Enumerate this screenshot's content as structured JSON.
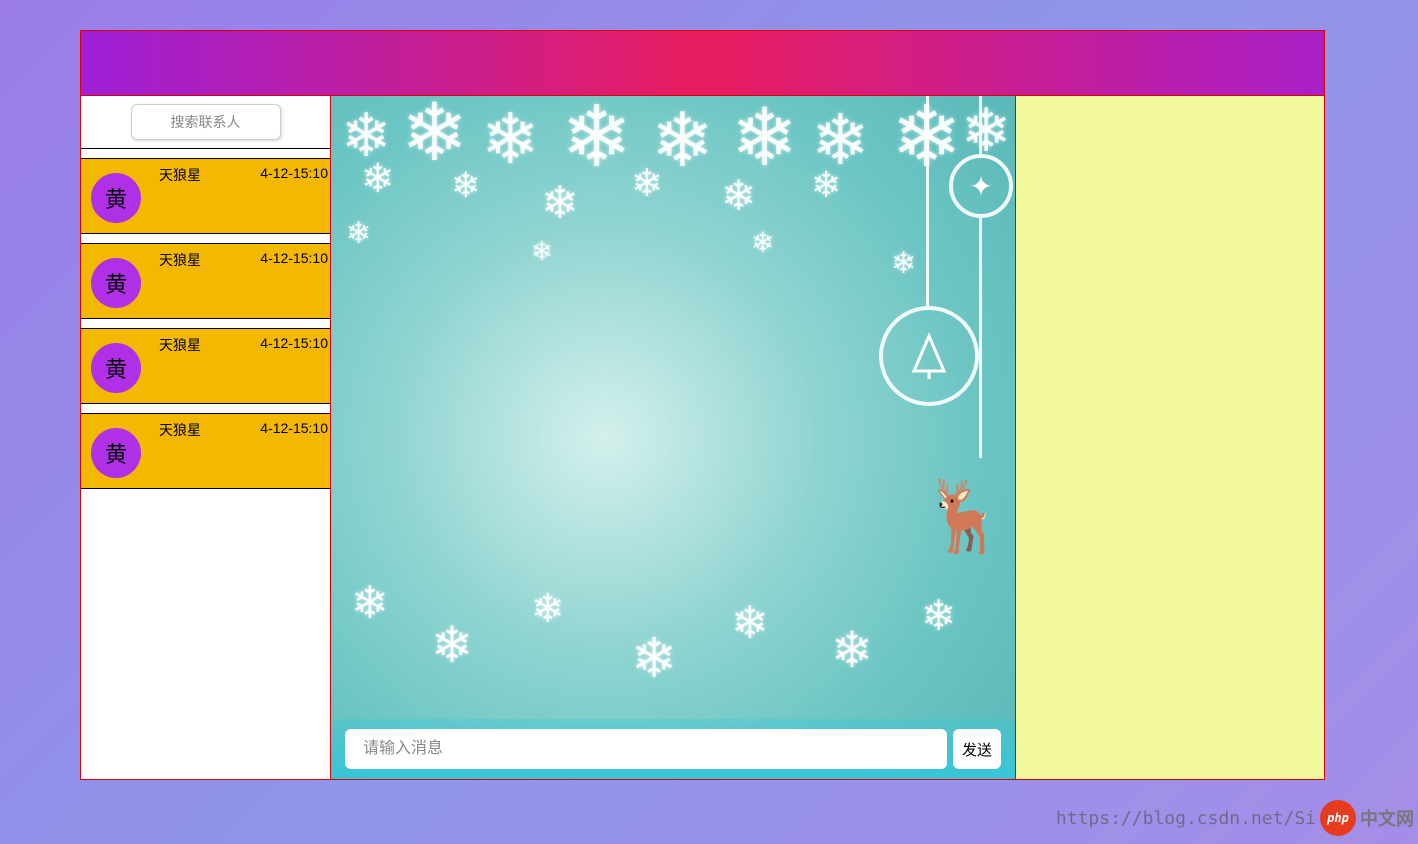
{
  "search": {
    "placeholder": "搜索联系人"
  },
  "contacts": [
    {
      "avatar_char": "黄",
      "name": "天狼星",
      "time": "4-12-15:10"
    },
    {
      "avatar_char": "黄",
      "name": "天狼星",
      "time": "4-12-15:10"
    },
    {
      "avatar_char": "黄",
      "name": "天狼星",
      "time": "4-12-15:10"
    },
    {
      "avatar_char": "黄",
      "name": "天狼星",
      "time": "4-12-15:10"
    }
  ],
  "message": {
    "placeholder": "请输入消息",
    "send_label": "发送"
  },
  "watermark": {
    "url_part": "https://blog.csdn.net/Si",
    "brand": "php",
    "suffix": "中文网"
  }
}
